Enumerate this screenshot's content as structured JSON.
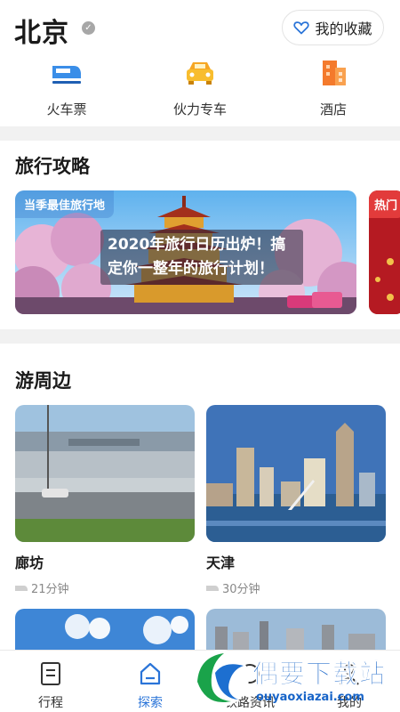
{
  "header": {
    "city": "北京",
    "favorite_label": "我的收藏"
  },
  "quick_links": [
    {
      "label": "火车票",
      "icon": "train-icon"
    },
    {
      "label": "伙力专车",
      "icon": "car-icon"
    },
    {
      "label": "酒店",
      "icon": "hotel-icon"
    }
  ],
  "guide": {
    "title": "旅行攻略",
    "banner_tag": "当季最佳旅行地",
    "banner_text": "2020年旅行日历出炉！搞定你一整年的旅行计划！",
    "banner2_tag": "热门"
  },
  "nearby": {
    "title": "游周边",
    "items": [
      {
        "name": "廊坊",
        "time": "21分钟"
      },
      {
        "name": "天津",
        "time": "30分钟"
      }
    ]
  },
  "tabbar": {
    "items": [
      {
        "label": "行程"
      },
      {
        "label": "探索"
      },
      {
        "label": "铁路资讯"
      },
      {
        "label": "我的"
      }
    ],
    "active_color": "#2a74d8"
  },
  "watermark": {
    "title": "偶要下载站",
    "url": "ouyaoxiazai.com"
  }
}
